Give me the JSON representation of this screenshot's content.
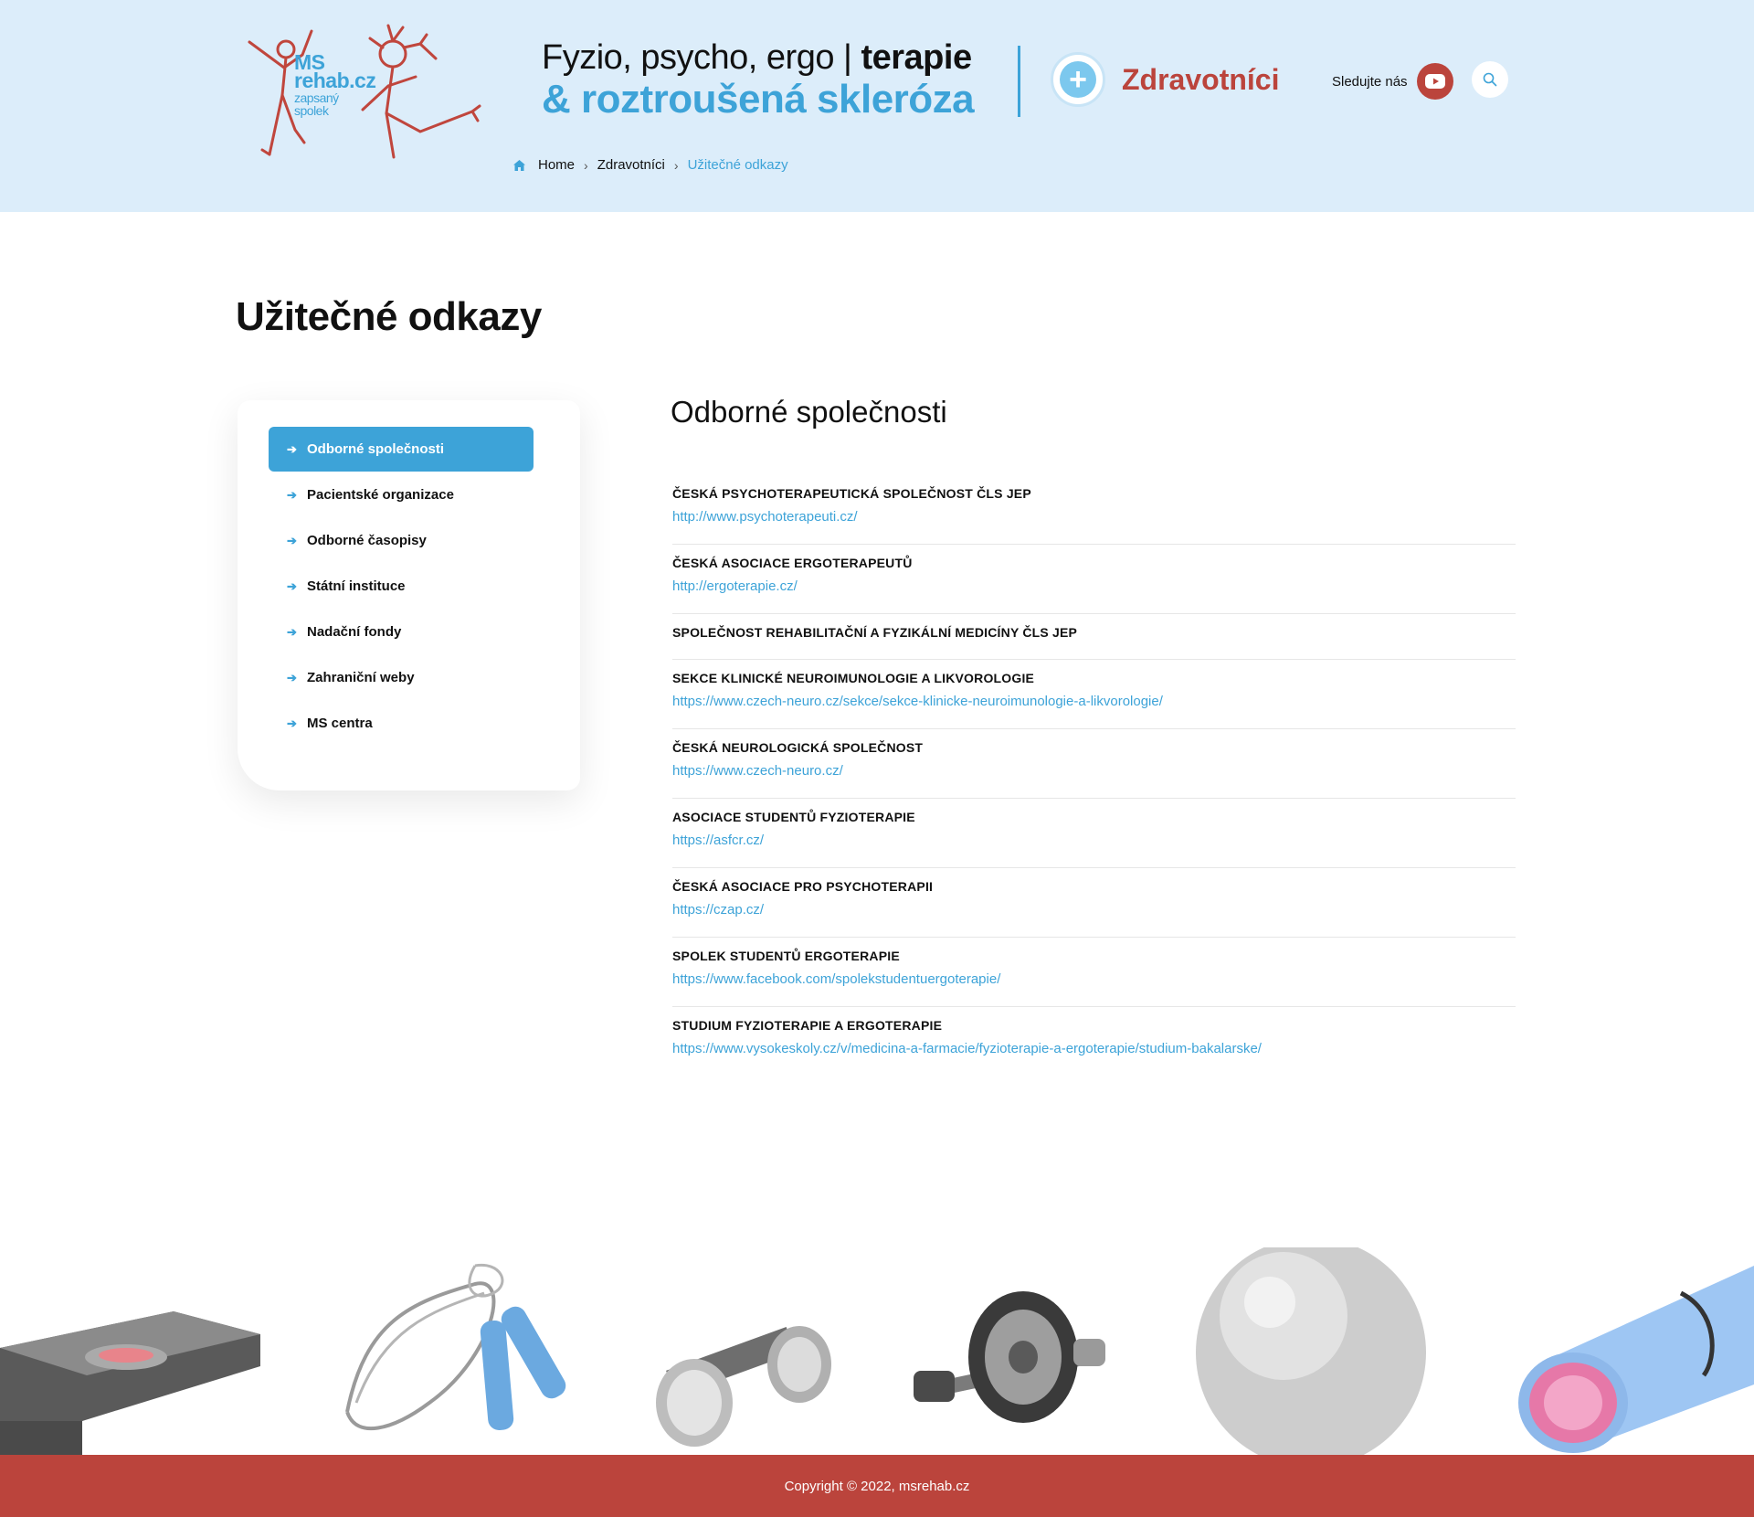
{
  "header": {
    "logo": {
      "line1": "MS",
      "line2": "rehab.cz",
      "line3": "zapsaný",
      "line4": "spolek"
    },
    "tagline_part1": "Fyzio, psycho, ergo | ",
    "tagline_bold": "terapie",
    "tagline_line2": "& roztroušená skleróza",
    "section_label": "Zdravotníci",
    "follow_label": "Sledujte nás",
    "icons": {
      "youtube": "youtube-icon",
      "search": "search-icon",
      "home": "home-icon",
      "plus": "plus-icon"
    }
  },
  "breadcrumb": {
    "home": "Home",
    "parent": "Zdravotníci",
    "current": "Užitečné odkazy"
  },
  "page_title": "Užitečné odkazy",
  "sidebar": {
    "items": [
      {
        "label": "Odborné společnosti"
      },
      {
        "label": "Pacientské organizace"
      },
      {
        "label": "Odborné časopisy"
      },
      {
        "label": "Státní instituce"
      },
      {
        "label": "Nadační fondy"
      },
      {
        "label": "Zahraniční weby"
      },
      {
        "label": "MS centra"
      }
    ]
  },
  "section_title": "Odborné společnosti",
  "links": [
    {
      "name": "Česká psychoterapeutická společnost ČLS JEP",
      "url": "http://www.psychoterapeuti.cz/"
    },
    {
      "name": "Česká asociace ergoterapeutů",
      "url": "http://ergoterapie.cz/"
    },
    {
      "name": "Společnost rehabilitační a fyzikální medicíny ČLS JEP",
      "url": ""
    },
    {
      "name": "Sekce klinické neuroimunologie a likvorologie",
      "url": "https://www.czech-neuro.cz/sekce/sekce-klinicke-neuroimunologie-a-likvorologie/"
    },
    {
      "name": "Česká neurologická společnost",
      "url": "https://www.czech-neuro.cz/"
    },
    {
      "name": "Asociace studentů fyzioterapie",
      "url": "https://asfcr.cz/"
    },
    {
      "name": "Česká asociace pro psychoterapii",
      "url": "https://czap.cz/"
    },
    {
      "name": "Spolek studentů ergoterapie",
      "url": "https://www.facebook.com/spolekstudentuergoterapie/"
    },
    {
      "name": "Studium fyzioterapie a ergoterapie",
      "url": "https://www.vysokeskoly.cz/v/medicina-a-farmacie/fyzioterapie-a-ergoterapie/studium-bakalarske/"
    }
  ],
  "footer": {
    "copyright": "Copyright © 2022, msrehab.cz"
  },
  "colors": {
    "accent_blue": "#3da3d8",
    "brand_red": "#bb443c",
    "header_bg": "#dcedfa"
  }
}
